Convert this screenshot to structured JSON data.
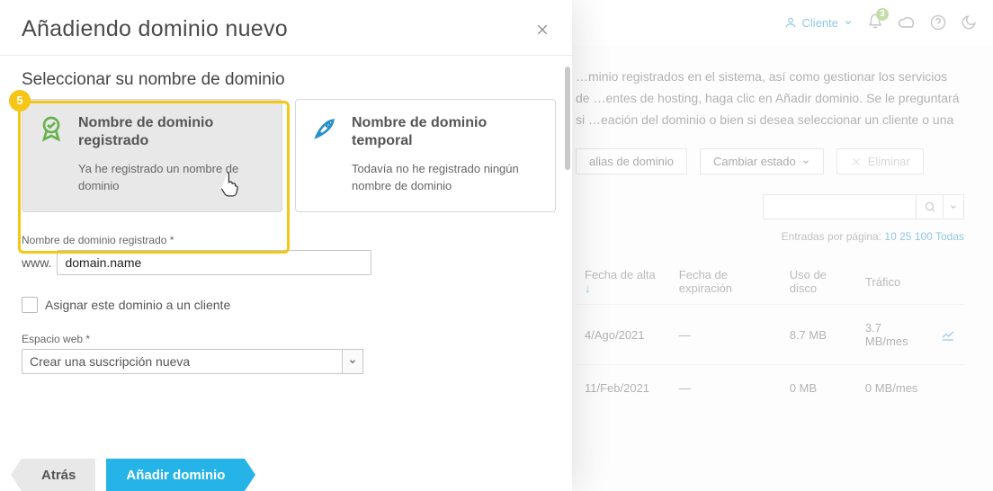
{
  "topbar": {
    "user_label": "Cliente",
    "notif_count": "3"
  },
  "background": {
    "help_text": "…minio registrados en el sistema, así como gestionar los servicios de …entes de hosting, haga clic en Añadir dominio. Se le preguntará si …eación del dominio o bien si desea seleccionar un cliente o una",
    "btn_alias": "alias de dominio",
    "btn_state": "Cambiar estado",
    "btn_delete": "Eliminar",
    "pager_prefix": "Entradas por página: ",
    "pager_options": [
      "10",
      "25",
      "100",
      "Todas"
    ],
    "table": {
      "cols": {
        "date": "Fecha de alta",
        "exp": "Fecha de expiración",
        "disk": "Uso de disco",
        "traffic": "Tráfico"
      },
      "rows": [
        {
          "date": "4/Ago/2021",
          "exp": "—",
          "disk": "8.7 MB",
          "traffic": "3.7 MB/mes"
        },
        {
          "date": "11/Feb/2021",
          "exp": "—",
          "disk": "0 MB",
          "traffic": "0 MB/mes"
        }
      ]
    }
  },
  "modal": {
    "title": "Añadiendo dominio nuevo",
    "section_title": "Seleccionar su nombre de dominio",
    "cards": {
      "registered": {
        "title": "Nombre de dominio registrado",
        "sub": "Ya he registrado un nombre de dominio"
      },
      "temporary": {
        "title": "Nombre de dominio temporal",
        "sub": "Todavía no he registrado ningún nombre de dominio"
      }
    },
    "step_number": "5",
    "domain_field": {
      "label": "Nombre de dominio registrado *",
      "prefix": "www.",
      "value": "domain.name"
    },
    "assign_client_label": "Asignar este dominio a un cliente",
    "webspace": {
      "label": "Espacio web *",
      "selected": "Crear una suscripción nueva"
    },
    "btn_back": "Atrás",
    "btn_submit": "Añadir dominio"
  }
}
